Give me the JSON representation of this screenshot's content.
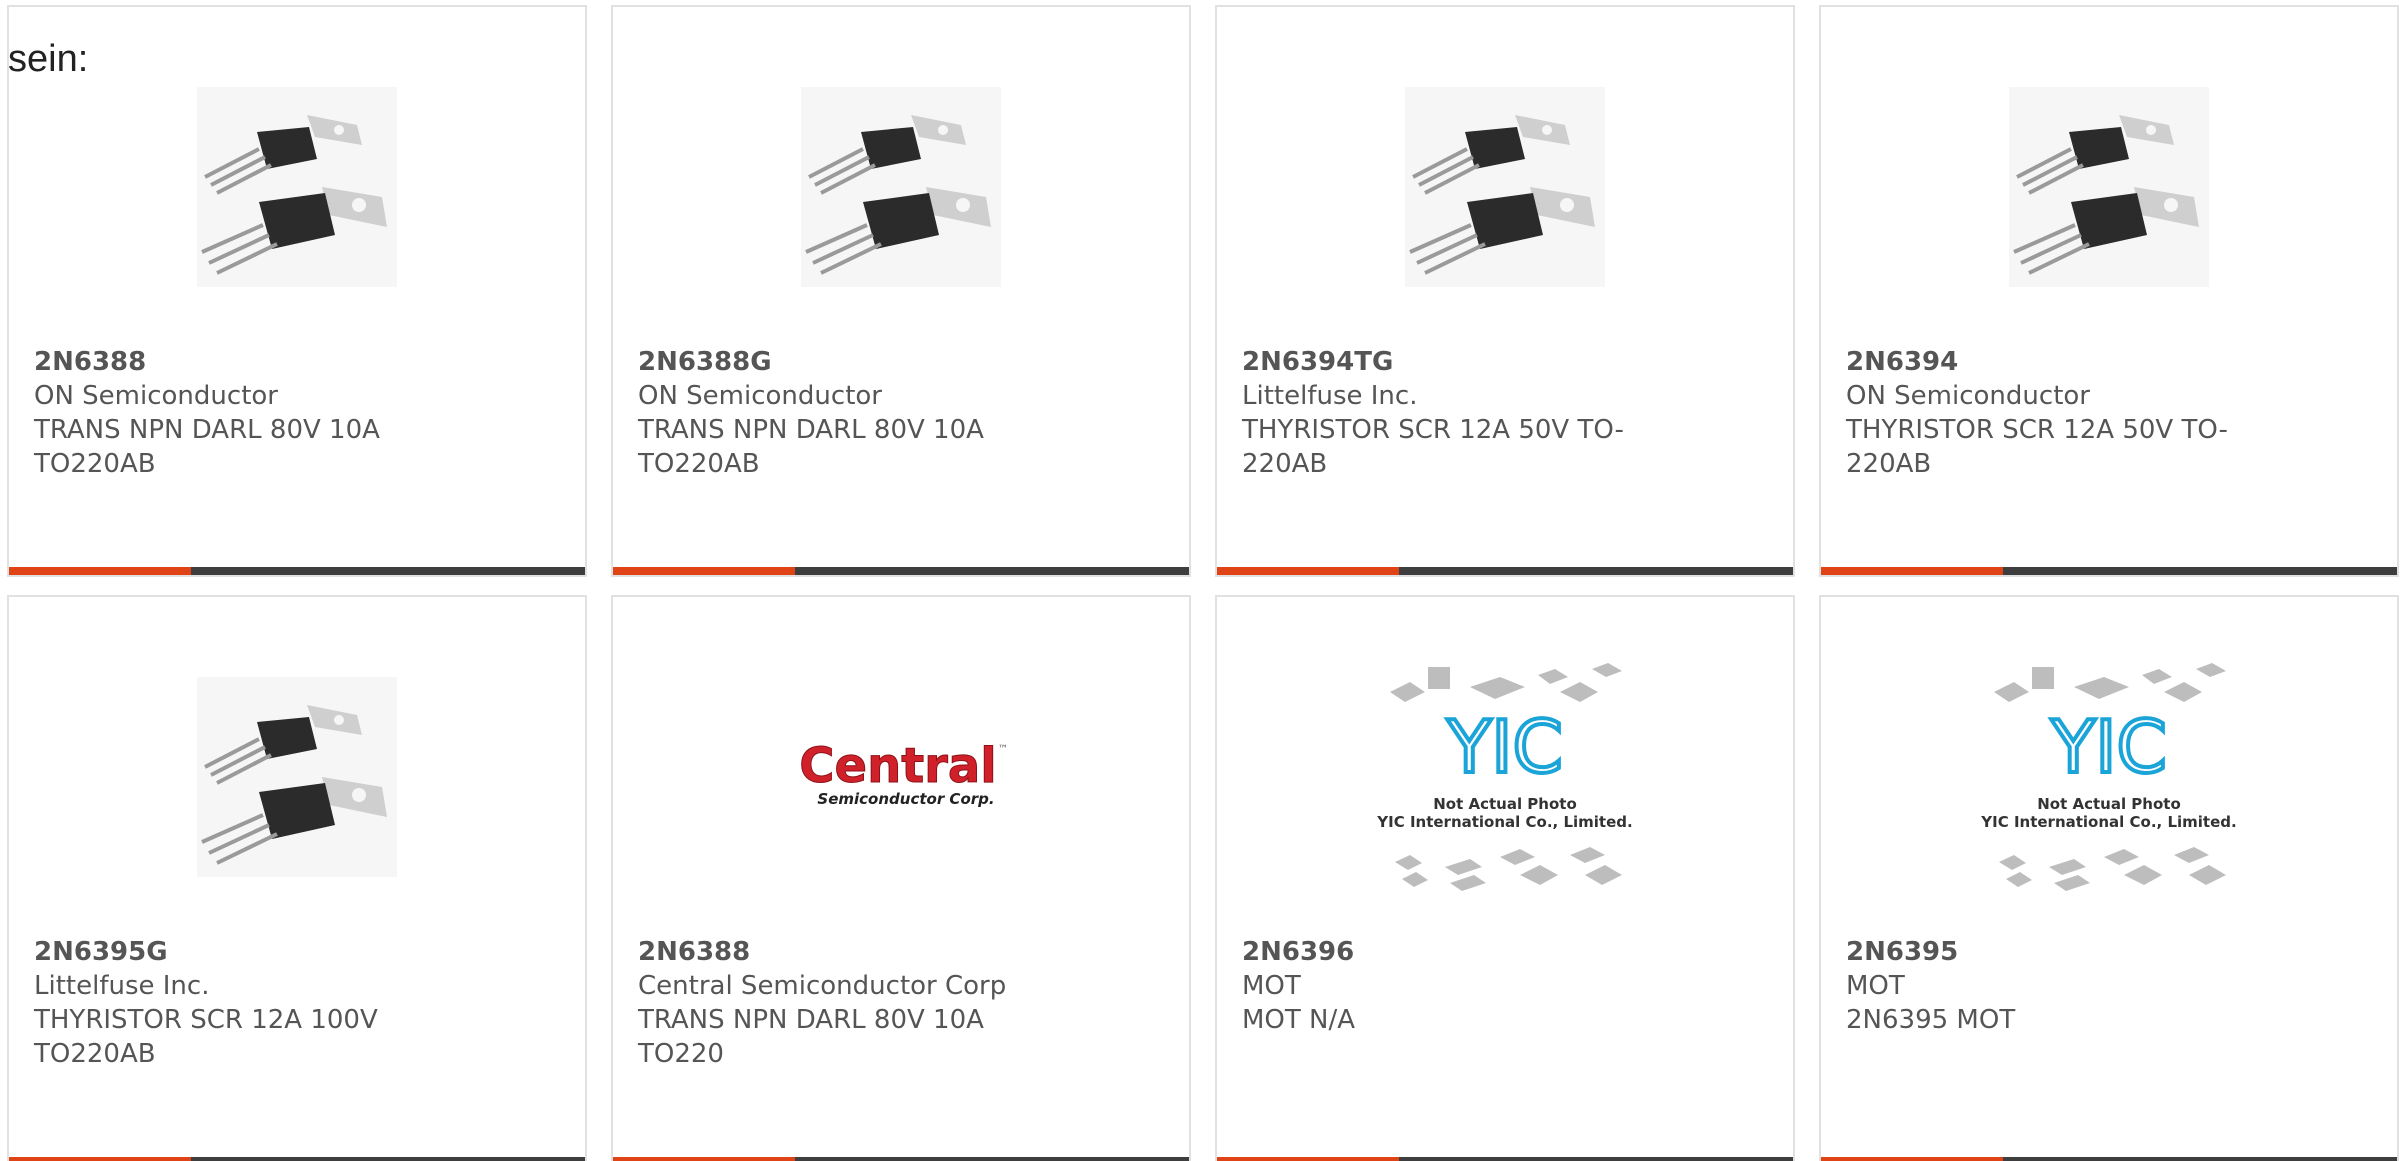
{
  "fragment_text": "sein:",
  "colors": {
    "accent": "#e04316",
    "bar": "#3e3e3e",
    "border": "#e1e1e1",
    "text": "#555555",
    "central_red": "#d0212a",
    "yic_blue": "#1aa4d8"
  },
  "cards": [
    {
      "image": "transistor-to220-photo",
      "part_no": "2N6388",
      "manufacturer": "ON Semiconductor",
      "desc1": "TRANS NPN DARL 80V 10A",
      "desc2": "TO220AB"
    },
    {
      "image": "transistor-to220-photo",
      "part_no": "2N6388G",
      "manufacturer": "ON Semiconductor",
      "desc1": "TRANS NPN DARL 80V 10A",
      "desc2": "TO220AB"
    },
    {
      "image": "transistor-to220-photo",
      "part_no": "2N6394TG",
      "manufacturer": "Littelfuse Inc.",
      "desc1": "THYRISTOR SCR 12A 50V TO-",
      "desc2": "220AB"
    },
    {
      "image": "transistor-to220-photo",
      "part_no": "2N6394",
      "manufacturer": "ON Semiconductor",
      "desc1": "THYRISTOR SCR 12A 50V TO-",
      "desc2": "220AB"
    },
    {
      "image": "transistor-to220-photo",
      "part_no": "2N6395G",
      "manufacturer": "Littelfuse Inc.",
      "desc1": "THYRISTOR SCR 12A 100V",
      "desc2": "TO220AB"
    },
    {
      "image": "central-logo",
      "part_no": "2N6388",
      "manufacturer": "Central Semiconductor Corp",
      "desc1": "TRANS NPN DARL 80V 10A",
      "desc2": "TO220"
    },
    {
      "image": "yic-not-actual-photo",
      "part_no": "2N6396",
      "manufacturer": "MOT",
      "desc1": "MOT N/A",
      "desc2": ""
    },
    {
      "image": "yic-not-actual-photo",
      "part_no": "2N6395",
      "manufacturer": "MOT",
      "desc1": "2N6395 MOT",
      "desc2": ""
    }
  ],
  "logos": {
    "central_name": "Central",
    "central_tm": "™",
    "central_sub": "Semiconductor Corp.",
    "yic_mark": "YIC",
    "yic_line1": "Not Actual Photo",
    "yic_line2": "YIC International Co., Limited."
  }
}
